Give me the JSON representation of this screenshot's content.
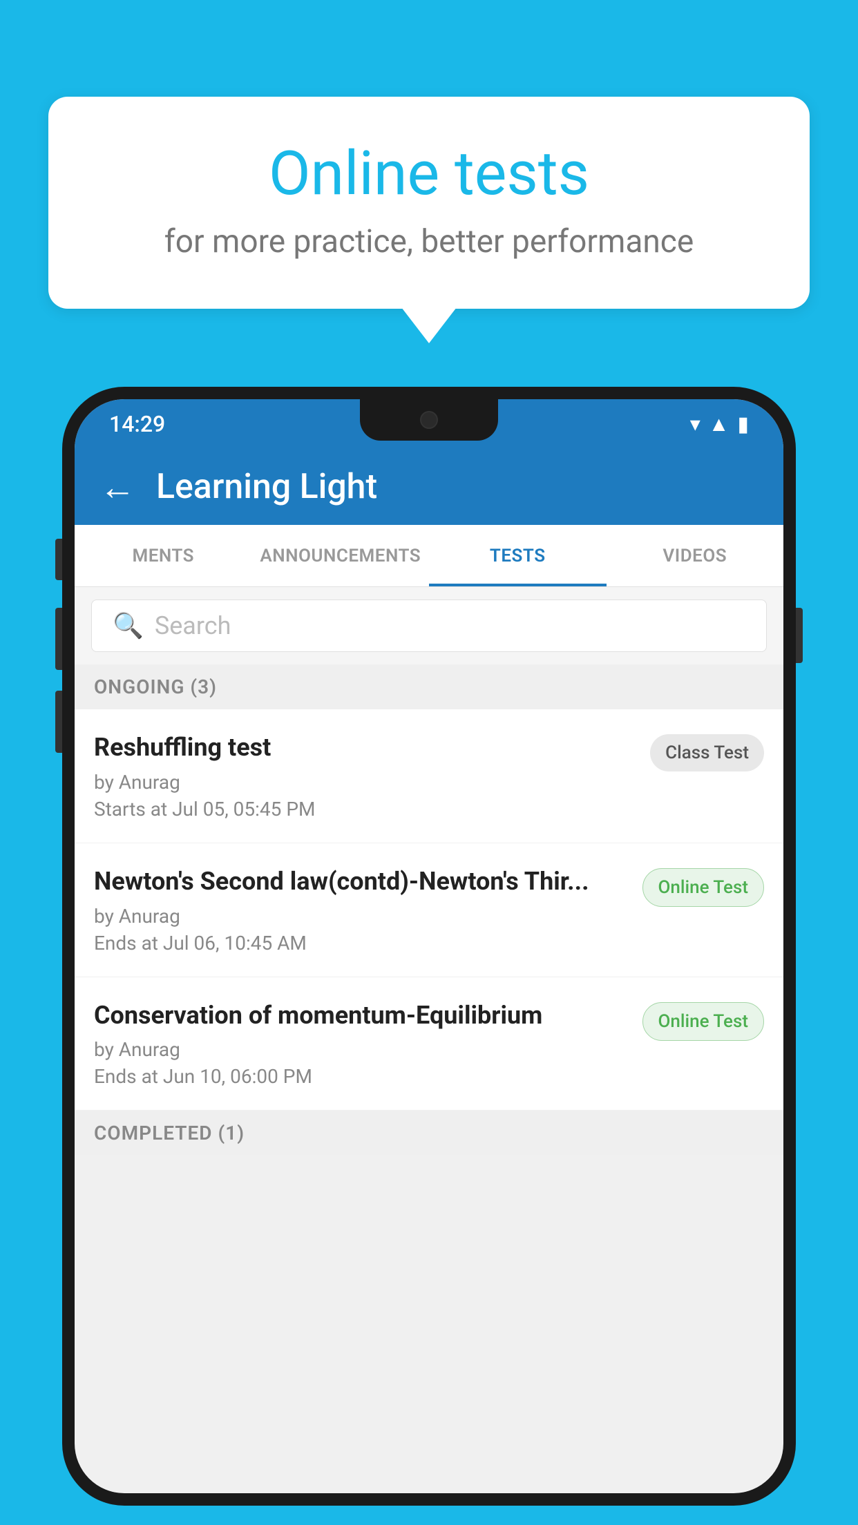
{
  "bubble": {
    "title": "Online tests",
    "subtitle": "for more practice, better performance"
  },
  "phone": {
    "status_time": "14:29",
    "header": {
      "title": "Learning Light",
      "back_label": "←"
    },
    "tabs": [
      {
        "label": "MENTS",
        "active": false
      },
      {
        "label": "ANNOUNCEMENTS",
        "active": false
      },
      {
        "label": "TESTS",
        "active": true
      },
      {
        "label": "VIDEOS",
        "active": false
      }
    ],
    "search": {
      "placeholder": "Search"
    },
    "ongoing_section": {
      "label": "ONGOING (3)"
    },
    "tests": [
      {
        "name": "Reshuffling test",
        "author": "by Anurag",
        "time": "Starts at  Jul 05, 05:45 PM",
        "badge": "Class Test",
        "badge_type": "class"
      },
      {
        "name": "Newton's Second law(contd)-Newton's Thir...",
        "author": "by Anurag",
        "time": "Ends at  Jul 06, 10:45 AM",
        "badge": "Online Test",
        "badge_type": "online"
      },
      {
        "name": "Conservation of momentum-Equilibrium",
        "author": "by Anurag",
        "time": "Ends at  Jun 10, 06:00 PM",
        "badge": "Online Test",
        "badge_type": "online"
      }
    ],
    "completed_section": {
      "label": "COMPLETED (1)"
    }
  }
}
